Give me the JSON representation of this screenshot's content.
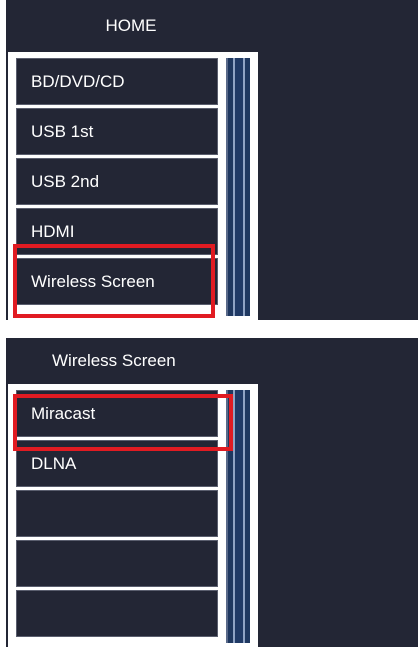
{
  "home_panel": {
    "title": "HOME",
    "items": [
      {
        "label": "BD/DVD/CD"
      },
      {
        "label": "USB 1st"
      },
      {
        "label": "USB 2nd"
      },
      {
        "label": "HDMI"
      },
      {
        "label": "Wireless Screen"
      }
    ],
    "highlighted_item": "Wireless Screen"
  },
  "wireless_panel": {
    "title": "Wireless Screen",
    "items": [
      {
        "label": "Miracast"
      },
      {
        "label": "DLNA"
      },
      {
        "label": ""
      },
      {
        "label": ""
      },
      {
        "label": ""
      }
    ],
    "highlighted_item": "Miracast"
  },
  "colors": {
    "background": "#232635",
    "highlight": "#e11b22",
    "scrollbar": "#1f3860"
  }
}
